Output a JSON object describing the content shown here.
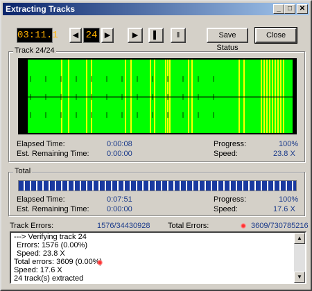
{
  "window": {
    "title": "Extracting Tracks",
    "minimize": "_",
    "maximize": "□",
    "close": "✕"
  },
  "toolbar": {
    "time": "03:11.1",
    "prev_track": "◀",
    "track_number": "24",
    "next_track": "▶",
    "play": "▶",
    "stop": "▌",
    "pause": "‖",
    "save_status": "Save Status",
    "close": "Close"
  },
  "track": {
    "group_label": "Track 24/24",
    "elapsed_label": "Elapsed Time:",
    "elapsed_value": "0:00:08",
    "remaining_label": "Est. Remaining Time:",
    "remaining_value": "0:00:00",
    "progress_label": "Progress:",
    "progress_value": "100%",
    "speed_label": "Speed:",
    "speed_value": "23.8 X",
    "progress_fraction": 1.0
  },
  "total": {
    "group_label": "Total",
    "elapsed_label": "Elapsed Time:",
    "elapsed_value": "0:07:51",
    "remaining_label": "Est. Remaining Time:",
    "remaining_value": "0:00:00",
    "progress_label": "Progress:",
    "progress_value": "100%",
    "speed_label": "Speed:",
    "speed_value": "17.6 X",
    "progress_fraction": 1.0
  },
  "errors": {
    "track_label": "Track Errors:",
    "track_value": "1576/34430928",
    "total_label": "Total Errors:",
    "total_value": "3609/730785216"
  },
  "log": {
    "lines": [
      "---> Verifying track 24",
      "Errors: 1576 (0.00%)",
      "Speed: 23.8 X",
      "Total errors: 3609 (0.00%)",
      "Speed: 17.6 X",
      "24 track(s) extracted"
    ]
  },
  "colors": {
    "lcd_text": "#ffb000",
    "wave_green": "#00ff00",
    "wave_yellow": "#ffff00",
    "progress_blue": "#1a3aa0",
    "value_blue": "#1a3a8a"
  }
}
